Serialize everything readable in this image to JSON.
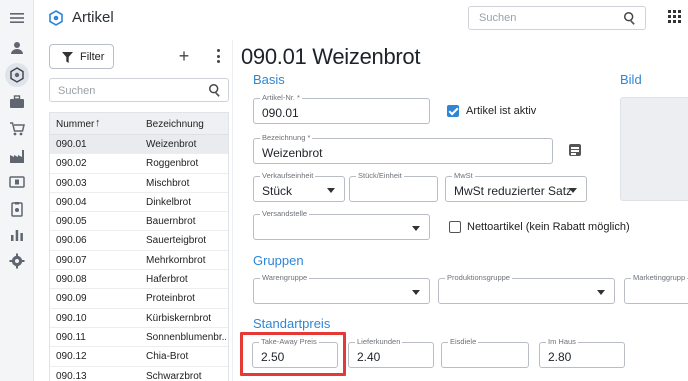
{
  "app": {
    "title": "Artikel"
  },
  "header": {
    "search_placeholder": "Suchen"
  },
  "rail": {
    "icons": [
      "menu-icon",
      "person-icon",
      "product-icon",
      "briefcase-icon",
      "cart-icon",
      "factory-icon",
      "cash-icon",
      "clipboard-icon",
      "chart-icon",
      "settings-icon"
    ]
  },
  "list": {
    "filter_label": "Filter",
    "search_placeholder": "Suchen",
    "columns": {
      "number": "Nummer",
      "name": "Bezeichnung"
    },
    "rows": [
      {
        "number": "090.01",
        "name": "Weizenbrot"
      },
      {
        "number": "090.02",
        "name": "Roggenbrot"
      },
      {
        "number": "090.03",
        "name": "Mischbrot"
      },
      {
        "number": "090.04",
        "name": "Dinkelbrot"
      },
      {
        "number": "090.05",
        "name": "Bauernbrot"
      },
      {
        "number": "090.06",
        "name": "Sauerteigbrot"
      },
      {
        "number": "090.07",
        "name": "Mehrkornbrot"
      },
      {
        "number": "090.08",
        "name": "Haferbrot"
      },
      {
        "number": "090.09",
        "name": "Proteinbrot"
      },
      {
        "number": "090.10",
        "name": "Kürbiskernbrot"
      },
      {
        "number": "090.11",
        "name": "Sonnenblumenbr..."
      },
      {
        "number": "090.12",
        "name": "Chia-Brot"
      },
      {
        "number": "090.13",
        "name": "Schwarzbrot"
      }
    ]
  },
  "detail": {
    "title": "090.01 Weizenbrot",
    "sections": {
      "basis": "Basis",
      "bild": "Bild",
      "gruppen": "Gruppen",
      "standardpreis": "Standartpreis"
    },
    "fields": {
      "artikel_nr": {
        "label": "Artikel-Nr. *",
        "value": "090.01"
      },
      "aktiv": {
        "label": "Artikel ist aktiv",
        "checked": true
      },
      "bezeichnung": {
        "label": "Bezeichnung *",
        "value": "Weizenbrot"
      },
      "verkaufseinheit": {
        "label": "Verkaufseinheit",
        "value": "Stück"
      },
      "stueck_einheit": {
        "label": "Stück/Einheit",
        "value": ""
      },
      "mwst": {
        "label": "MwSt",
        "value": "MwSt reduzierter Satz"
      },
      "versandstelle": {
        "label": "Versandstelle",
        "value": ""
      },
      "netto": {
        "label": "Nettoartikel (kein Rabatt möglich)",
        "checked": false
      },
      "warengruppe": {
        "label": "Warengruppe",
        "value": ""
      },
      "produktionsgruppe": {
        "label": "Produktionsgruppe",
        "value": ""
      },
      "marketinggruppe": {
        "label": "Marketinggrupp",
        "value": ""
      },
      "take_away": {
        "label": "Take-Away Preis",
        "value": "2.50"
      },
      "lieferkunden": {
        "label": "Lieferkunden",
        "value": "2.40"
      },
      "eisdiele": {
        "label": "Eisdiele",
        "value": ""
      },
      "im_haus": {
        "label": "Im Haus",
        "value": "2.80"
      }
    }
  },
  "colors": {
    "accent": "#2f86d6",
    "highlight": "#e53935",
    "selected_row": "#e9ebef"
  }
}
